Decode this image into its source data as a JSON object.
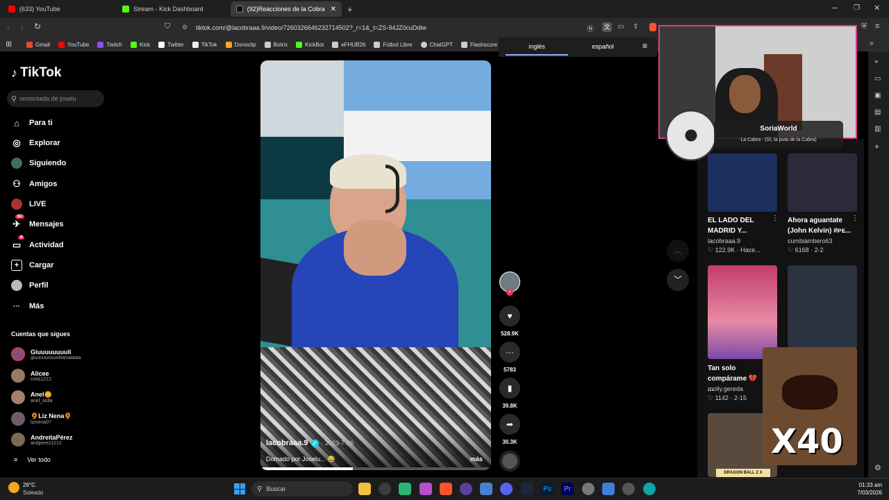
{
  "browser": {
    "tabs": [
      {
        "label": "(633) YouTube",
        "color": "#ff0000"
      },
      {
        "label": "Stream - Kick Dashboard",
        "color": "#53fc18"
      },
      {
        "label": "(92)Reacciones de la Cobra a",
        "color": "#ffffff",
        "active": true
      }
    ],
    "url": "tiktok.com/@lacobraaa.9/video/7260326646232714502?_r=1&_t=ZS-94JZ0cuDdlw",
    "bookmarks": [
      {
        "label": "Gmail",
        "color": "#ea4335"
      },
      {
        "label": "YouTube",
        "color": "#ff0000"
      },
      {
        "label": "Twitch",
        "color": "#9146ff"
      },
      {
        "label": "Kick",
        "color": "#53fc18"
      },
      {
        "label": "Twitter",
        "color": "#ffffff"
      },
      {
        "label": "TikTok",
        "color": "#ffffff"
      },
      {
        "label": "Donoclip",
        "color": "#f5a623"
      },
      {
        "label": "Botrix",
        "color": "#cccccc"
      },
      {
        "label": "KickBot",
        "color": "#53fc18"
      },
      {
        "label": "eFHUB26",
        "color": "#cccccc"
      },
      {
        "label": "Fútbol Libre",
        "color": "#cccccc"
      },
      {
        "label": "ChatGPT",
        "color": "#cccccc"
      },
      {
        "label": "Flashscore",
        "color": "#cccccc"
      }
    ],
    "translate": {
      "lang1": "inglés",
      "lang2": "español"
    }
  },
  "tiktok": {
    "logo": "TikTok",
    "search_placeholder": "remontada de joselu",
    "nav": [
      {
        "label": "Para ti",
        "icon": "home-icon",
        "glyph": "⌂"
      },
      {
        "label": "Explorar",
        "icon": "compass-icon",
        "glyph": "◎"
      },
      {
        "label": "Siguiendo",
        "icon": "following-icon",
        "glyph": "◉"
      },
      {
        "label": "Amigos",
        "icon": "friends-icon",
        "glyph": "⚇"
      },
      {
        "label": "LIVE",
        "icon": "live-icon",
        "glyph": "●"
      },
      {
        "label": "Mensajes",
        "icon": "messages-icon",
        "glyph": "✈",
        "badge": "83"
      },
      {
        "label": "Actividad",
        "icon": "activity-icon",
        "glyph": "▭",
        "badge": "9"
      },
      {
        "label": "Cargar",
        "icon": "upload-icon",
        "glyph": "+"
      },
      {
        "label": "Perfil",
        "icon": "profile-icon",
        "glyph": "◍"
      },
      {
        "label": "Más",
        "icon": "more-icon",
        "glyph": "···"
      }
    ],
    "following_title": "Cuentas que sigues",
    "following": [
      {
        "name": "Giuuuuuuuuli",
        "user": "giuuuuuuuuuliianaaaaa"
      },
      {
        "name": "Alicee",
        "user": "cmis1212"
      },
      {
        "name": "Anel🌼",
        "user": "anel_aslla"
      },
      {
        "name": "🌻Liz Nena🌻",
        "user": "liznena07"
      },
      {
        "name": "AndreitaPérez",
        "user": "andperez1212"
      }
    ],
    "see_all": "Ver todo",
    "video": {
      "author": "lacobraaa.9",
      "date": "· 2023-7-26",
      "caption": "Domado por Joselu... 😂",
      "more": "más"
    },
    "actions": [
      {
        "icon": "heart-icon",
        "glyph": "♥",
        "count": "528.9K"
      },
      {
        "icon": "comment-icon",
        "glyph": "···",
        "count": "5783"
      },
      {
        "icon": "bookmark-icon",
        "glyph": "▮",
        "count": "39.8K"
      },
      {
        "icon": "share-icon",
        "glyph": "➦",
        "count": "30.3K"
      }
    ],
    "right_cards": [
      {
        "title": "EL LADO DEL MADRID Y...",
        "user": "lacobraaa.9",
        "stats": "♡ 122.9K · Hace..."
      },
      {
        "title": "Ahora aguantate (John Kelvin) #ᴘᴇ...",
        "user": "cumbiambero63",
        "stats": "♡ 6168 · 2-2"
      },
      {
        "title": "Tan solo compárame 💔 ...",
        "user": "molly.gereda",
        "stats": "♡ 1142 · 2-15"
      }
    ]
  },
  "overlay": {
    "music_user": "SoriaWorld",
    "music_track": "La Cabra - (Sí, la puta de la Cabra)",
    "meme_text": "X40",
    "sticker_text": "DRAGON BALL Z X"
  },
  "taskbar": {
    "weather_temp": "26°C",
    "weather_desc": "Soleado",
    "search_placeholder": "Buscar",
    "time": "01:33 am",
    "date": "7/03/2026"
  }
}
